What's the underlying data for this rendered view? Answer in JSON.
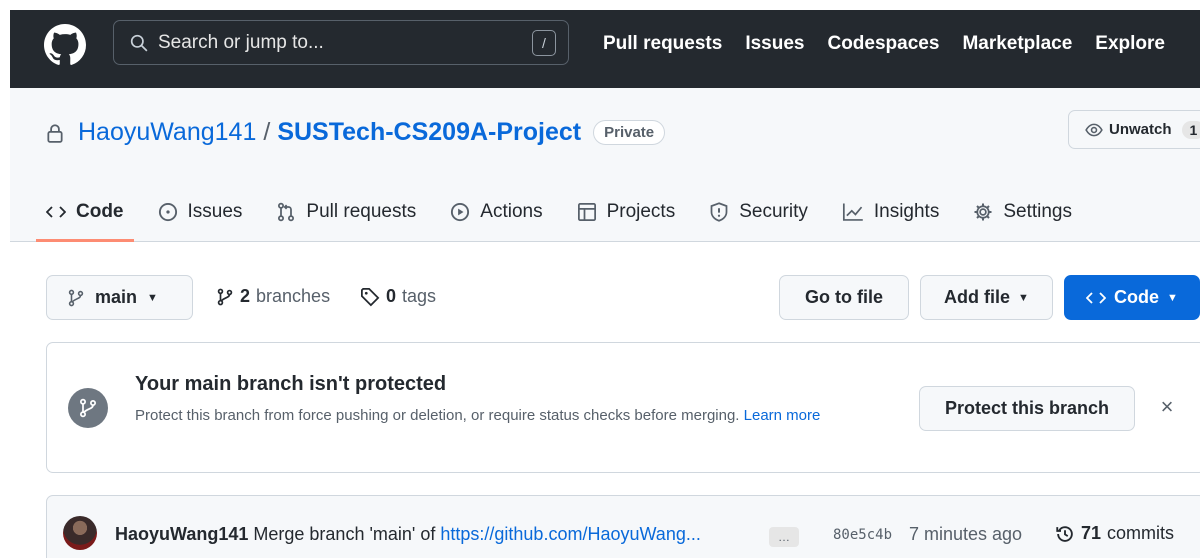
{
  "header": {
    "search_placeholder": "Search or jump to...",
    "search_shortcut": "/",
    "nav": [
      "Pull requests",
      "Issues",
      "Codespaces",
      "Marketplace",
      "Explore"
    ]
  },
  "repo": {
    "owner": "HaoyuWang141",
    "separator": "/",
    "name": "SUSTech-CS209A-Project",
    "visibility": "Private",
    "watch_label": "Unwatch",
    "watch_count": "1"
  },
  "tabs": [
    {
      "label": "Code",
      "icon": "code-icon",
      "active": true
    },
    {
      "label": "Issues",
      "icon": "issue-icon"
    },
    {
      "label": "Pull requests",
      "icon": "pull-request-icon"
    },
    {
      "label": "Actions",
      "icon": "play-icon"
    },
    {
      "label": "Projects",
      "icon": "table-icon"
    },
    {
      "label": "Security",
      "icon": "shield-icon"
    },
    {
      "label": "Insights",
      "icon": "graph-icon"
    },
    {
      "label": "Settings",
      "icon": "gear-icon"
    }
  ],
  "branch_bar": {
    "branch": "main",
    "branches_count": "2",
    "branches_label": "branches",
    "tags_count": "0",
    "tags_label": "tags",
    "goto_file": "Go to file",
    "add_file": "Add file",
    "code_button": "Code"
  },
  "protection": {
    "title": "Your main branch isn't protected",
    "description": "Protect this branch from force pushing or deletion, or require status checks before merging.",
    "learn_more": "Learn more",
    "button": "Protect this branch",
    "dismiss": "×"
  },
  "commit": {
    "author": "HaoyuWang141",
    "message": "Merge branch 'main' of",
    "link": "https://github.com/HaoyuWang...",
    "ellipsis": "…",
    "sha": "80e5c4b",
    "time": "7 minutes ago",
    "count": "71",
    "count_label": "commits"
  },
  "colors": {
    "header_bg": "#24292f",
    "link": "#0969da",
    "primary_button": "#0969da",
    "tab_underline": "#fd8c73"
  }
}
